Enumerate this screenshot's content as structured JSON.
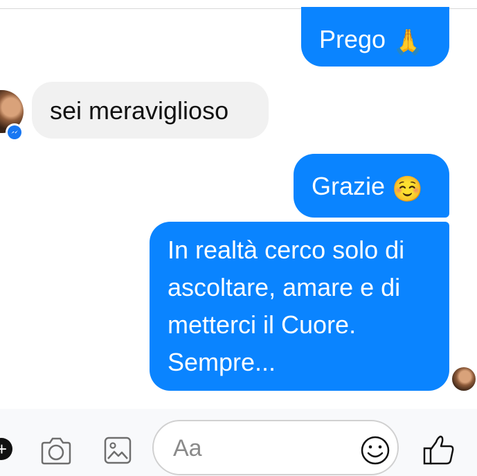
{
  "conversation": {
    "messages": [
      {
        "text": "Prego",
        "emoji": "🙏",
        "direction": "outgoing"
      },
      {
        "text": "sei meraviglioso",
        "direction": "incoming"
      },
      {
        "text": "Grazie",
        "emoji": "☺️",
        "direction": "outgoing"
      },
      {
        "lines": [
          "In realtà cerco solo di",
          "ascoltare, amare e di",
          "metterci il Cuore.",
          "Sempre..."
        ],
        "direction": "outgoing"
      }
    ]
  },
  "composer": {
    "placeholder": "Aa",
    "icons": [
      "add-icon",
      "camera-icon",
      "gallery-icon",
      "emoji-icon",
      "thumbs-up-icon"
    ]
  },
  "colors": {
    "outgoing_bubble": "#0a84ff",
    "incoming_bubble": "#f1f1f1",
    "messenger_badge": "#1877f2"
  }
}
